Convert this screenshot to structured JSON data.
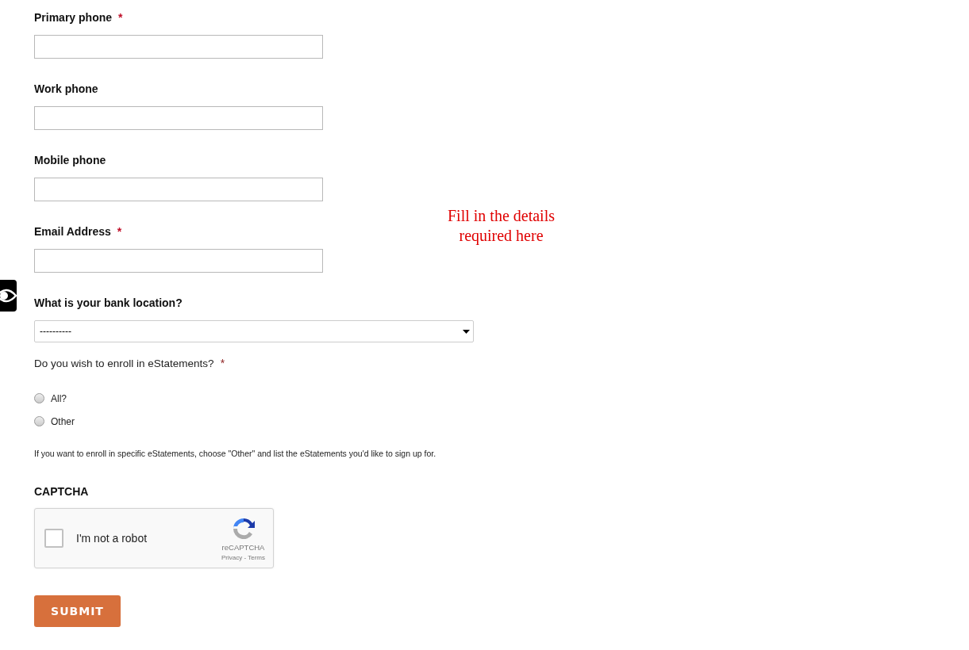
{
  "fields": [
    {
      "label": "Primary phone",
      "mark": "*"
    },
    {
      "label": "Work phone"
    },
    {
      "label": "Mobile phone"
    },
    {
      "label": "Email Address",
      "mark": "*"
    }
  ],
  "bank": {
    "label": "What is your bank location?",
    "value": "----------"
  },
  "enroll": {
    "question": "Do you wish to enroll in eStatements?",
    "mark": "*",
    "options": [
      {
        "label": "All?",
        "selected": false
      },
      {
        "label": "Other",
        "selected": false
      }
    ],
    "note": "If you want to enroll in specific eStatements, choose \"Other\" and list the eStatements you'd like to sign up for."
  },
  "captcha": {
    "label": "CAPTCHA",
    "checked": false,
    "text": "I'm not a robot",
    "brand": "reCAPTCHA",
    "links": "Privacy - Terms"
  },
  "submit": "SUBMIT",
  "annotation": "Fill in the details required here"
}
